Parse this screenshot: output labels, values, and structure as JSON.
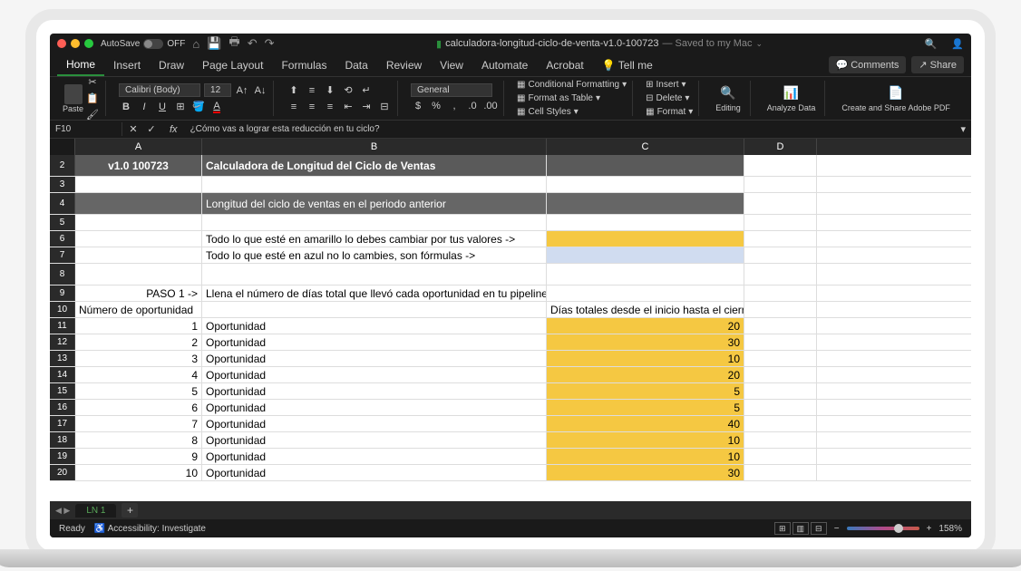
{
  "titlebar": {
    "autosave": "AutoSave",
    "autosave_state": "OFF",
    "filename": "calculadora-longitud-ciclo-de-venta-v1.0-100723",
    "saved": "— Saved to my Mac"
  },
  "tabs": [
    "Home",
    "Insert",
    "Draw",
    "Page Layout",
    "Formulas",
    "Data",
    "Review",
    "View",
    "Automate",
    "Acrobat"
  ],
  "tellme": "Tell me",
  "comments": "Comments",
  "share": "Share",
  "ribbon": {
    "paste": "Paste",
    "font": "Calibri (Body)",
    "size": "12",
    "numfmt": "General",
    "cond": "Conditional Formatting",
    "table": "Format as Table",
    "styles": "Cell Styles",
    "insert": "Insert",
    "delete": "Delete",
    "format": "Format",
    "editing": "Editing",
    "analyze": "Analyze Data",
    "adobe": "Create and Share Adobe PDF"
  },
  "namebox": "F10",
  "formula": "¿Cómo vas a lograr esta reducción en tu ciclo?",
  "cols": [
    "A",
    "B",
    "C",
    "D"
  ],
  "sheet": {
    "version": "v1.0 100723",
    "title": "Calculadora de Longitud del Ciclo de Ventas",
    "section": "Longitud del ciclo de ventas en el periodo anterior",
    "yellow_note": "Todo lo que esté en amarillo lo debes cambiar por tus valores ->",
    "blue_note": "Todo lo que esté en azul no lo cambies, son fórmulas ->",
    "paso": "PASO 1 ->",
    "paso_text": "Llena el número de días total que llevó cada oportunidad en tu pipeline",
    "numop": "Número de oportunidad",
    "dias": "Días totales desde el inicio hasta el cierre",
    "ops": [
      {
        "n": "1",
        "label": "Oportunidad",
        "days": "20"
      },
      {
        "n": "2",
        "label": "Oportunidad",
        "days": "30"
      },
      {
        "n": "3",
        "label": "Oportunidad",
        "days": "10"
      },
      {
        "n": "4",
        "label": "Oportunidad",
        "days": "20"
      },
      {
        "n": "5",
        "label": "Oportunidad",
        "days": "5"
      },
      {
        "n": "6",
        "label": "Oportunidad",
        "days": "5"
      },
      {
        "n": "7",
        "label": "Oportunidad",
        "days": "40"
      },
      {
        "n": "8",
        "label": "Oportunidad",
        "days": "10"
      },
      {
        "n": "9",
        "label": "Oportunidad",
        "days": "10"
      },
      {
        "n": "10",
        "label": "Oportunidad",
        "days": "30"
      }
    ]
  },
  "sheet_tab": "LN 1",
  "status": {
    "ready": "Ready",
    "access": "Accessibility: Investigate",
    "zoom": "158%"
  }
}
